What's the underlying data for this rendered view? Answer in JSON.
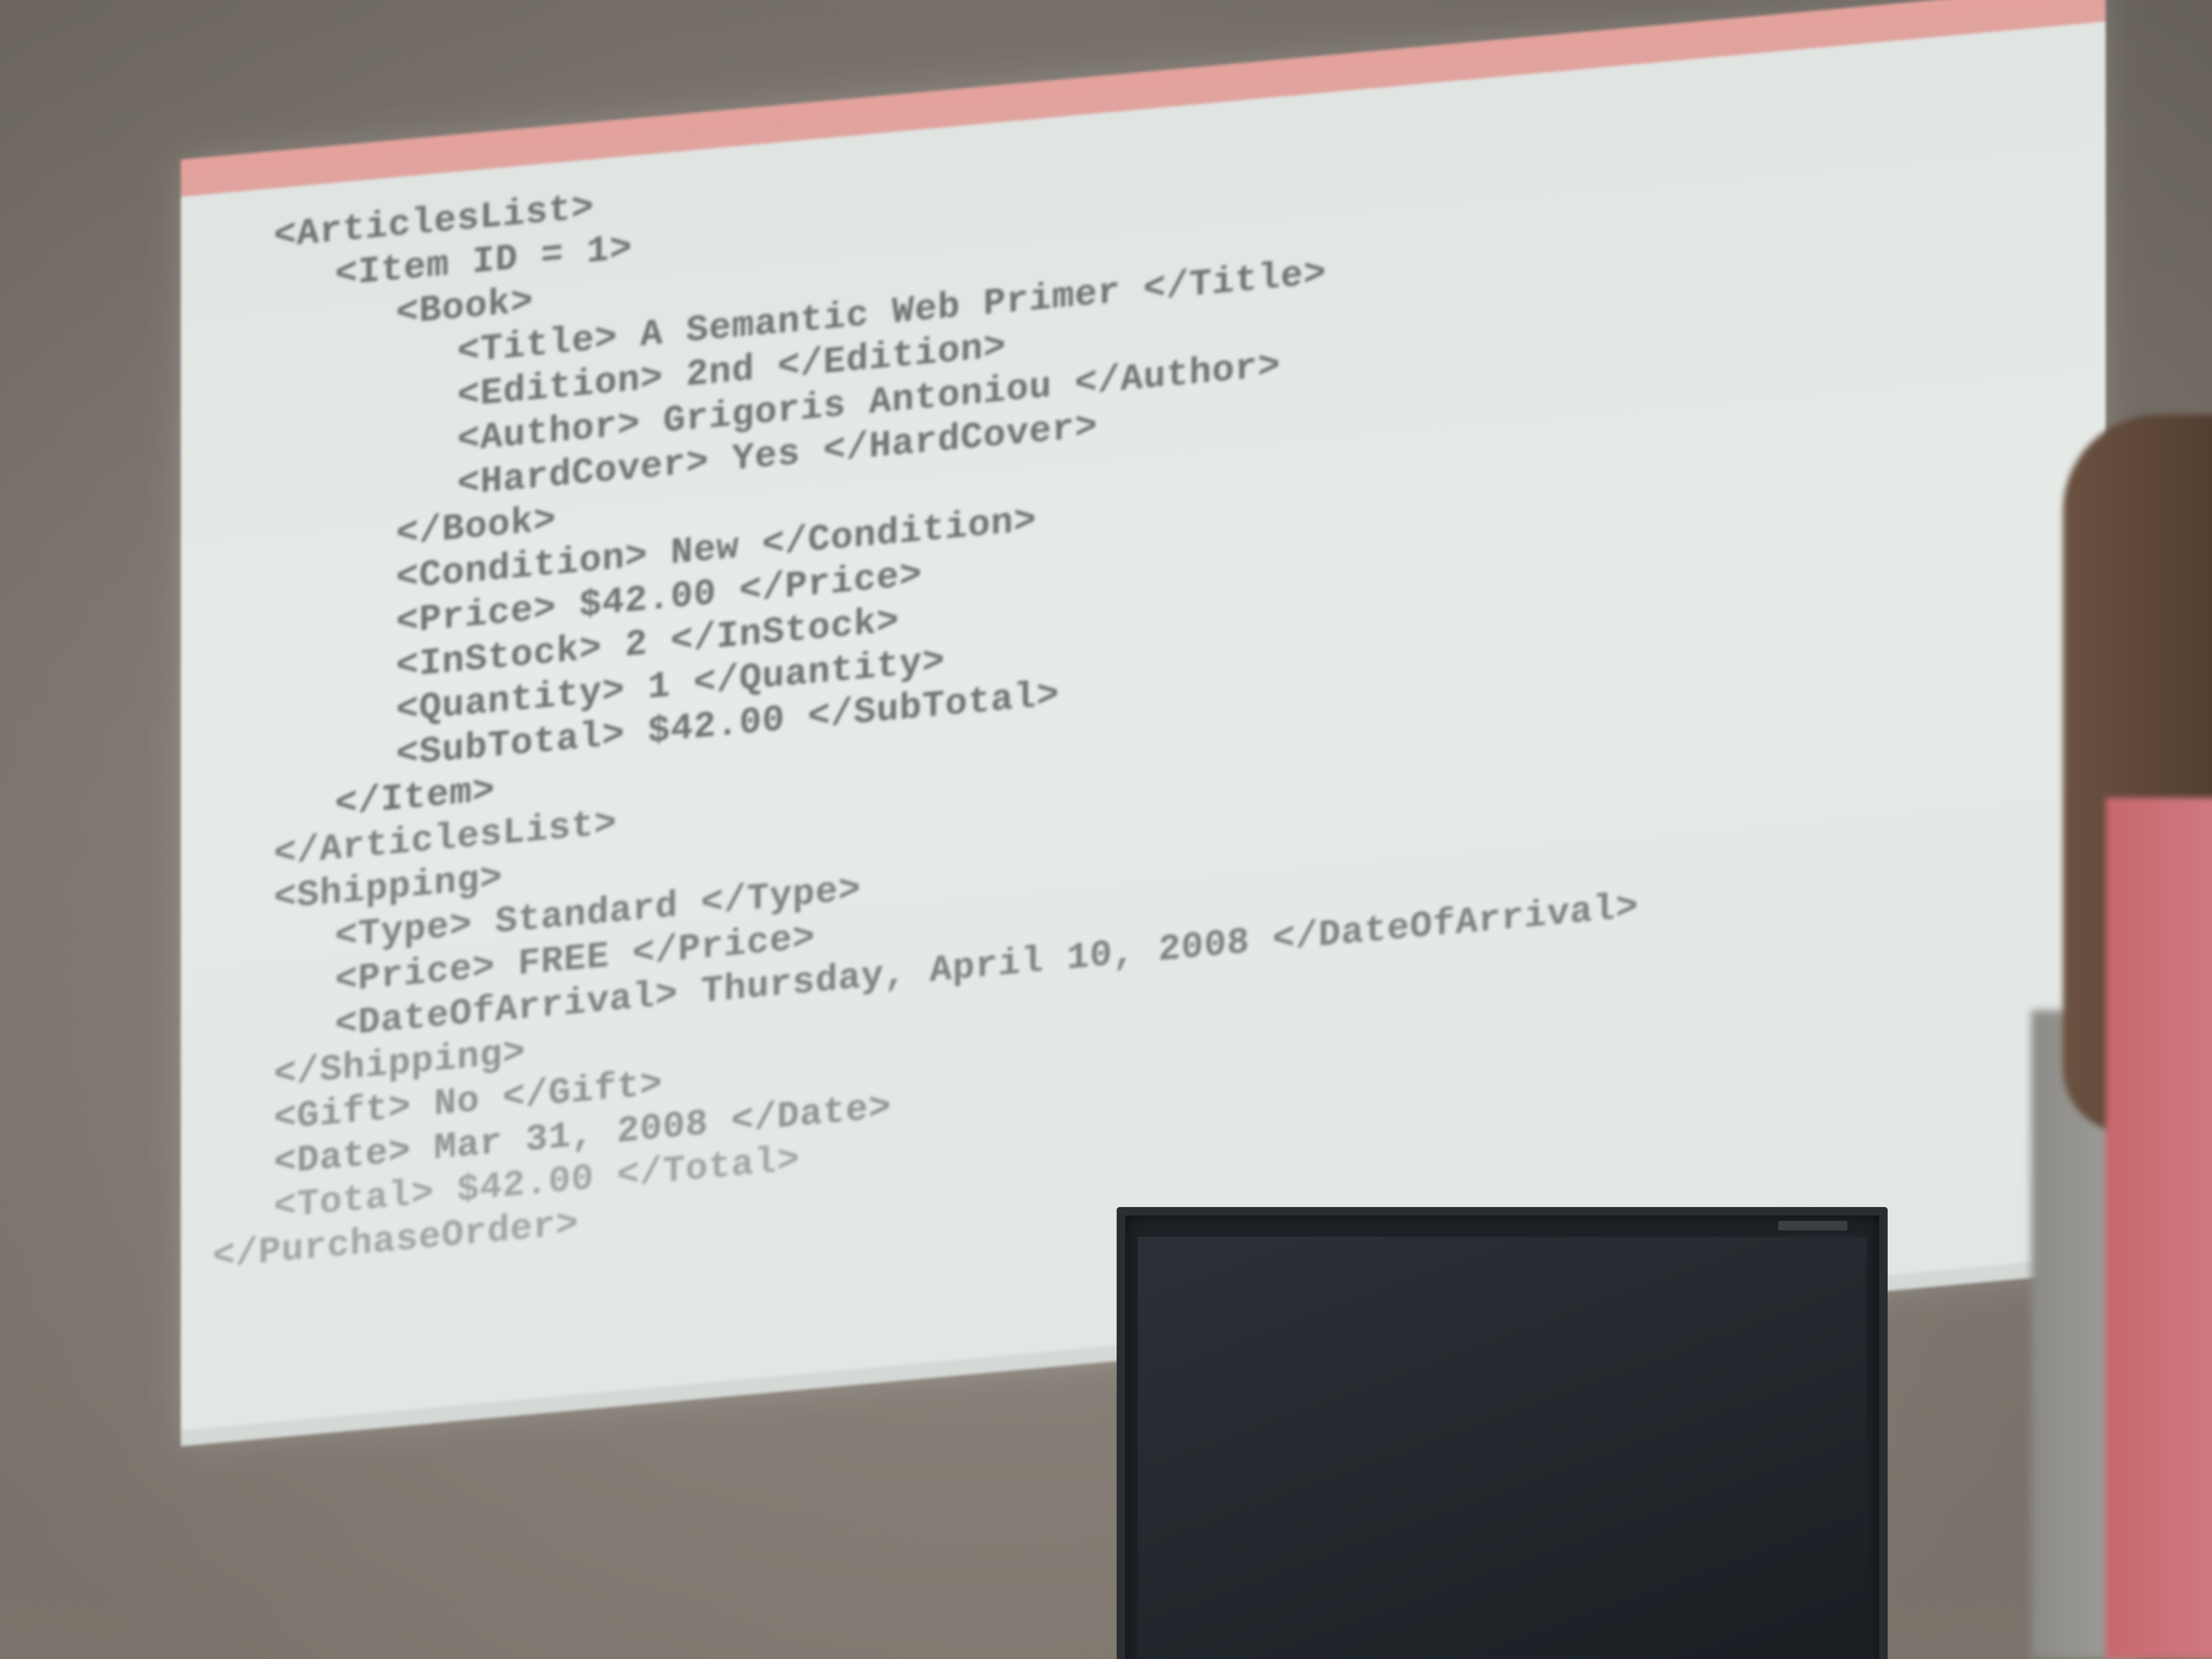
{
  "code_lines": [
    {
      "text": "<ArticlesList>",
      "indent": 1
    },
    {
      "text": "<Item ID = 1>",
      "indent": 2
    },
    {
      "text": "<Book>",
      "indent": 3
    },
    {
      "text": "<Title> A Semantic Web Primer </Title>",
      "indent": 4
    },
    {
      "text": "<Edition> 2nd </Edition>",
      "indent": 4
    },
    {
      "text": "<Author> Grigoris Antoniou </Author>",
      "indent": 4
    },
    {
      "text": "<HardCover> Yes </HardCover>",
      "indent": 4
    },
    {
      "text": "</Book>",
      "indent": 3
    },
    {
      "text": "<Condition> New </Condition>",
      "indent": 3
    },
    {
      "text": "<Price> $42.00 </Price>",
      "indent": 3
    },
    {
      "text": "<InStock> 2 </InStock>",
      "indent": 3
    },
    {
      "text": "<Quantity> 1 </Quantity>",
      "indent": 3
    },
    {
      "text": "<SubTotal> $42.00 </SubTotal>",
      "indent": 3
    },
    {
      "text": "</Item>",
      "indent": 2
    },
    {
      "text": "</ArticlesList>",
      "indent": 1
    },
    {
      "text": "<Shipping>",
      "indent": 1
    },
    {
      "text": "<Type> Standard </Type>",
      "indent": 2
    },
    {
      "text": "<Price> FREE </Price>",
      "indent": 2
    },
    {
      "text": "<DateOfArrival> Thursday, April 10, 2008 </DateOfArrival>",
      "indent": 2
    },
    {
      "text": "</Shipping>",
      "indent": 1
    },
    {
      "text": "<Gift> No </Gift>",
      "indent": 1
    },
    {
      "text": "<Date> Mar 31, 2008 </Date>",
      "indent": 1
    },
    {
      "text": "<Total> $42.00 </Total>",
      "indent": 1
    },
    {
      "text": "</PurchaseOrder>",
      "indent": 0
    }
  ],
  "colors": {
    "title_bar": "#e5a29c",
    "screen_background": "#e3e7e4",
    "code_text": "#6f7571",
    "monitor": "#1e2227",
    "wall": "#8a8279"
  }
}
